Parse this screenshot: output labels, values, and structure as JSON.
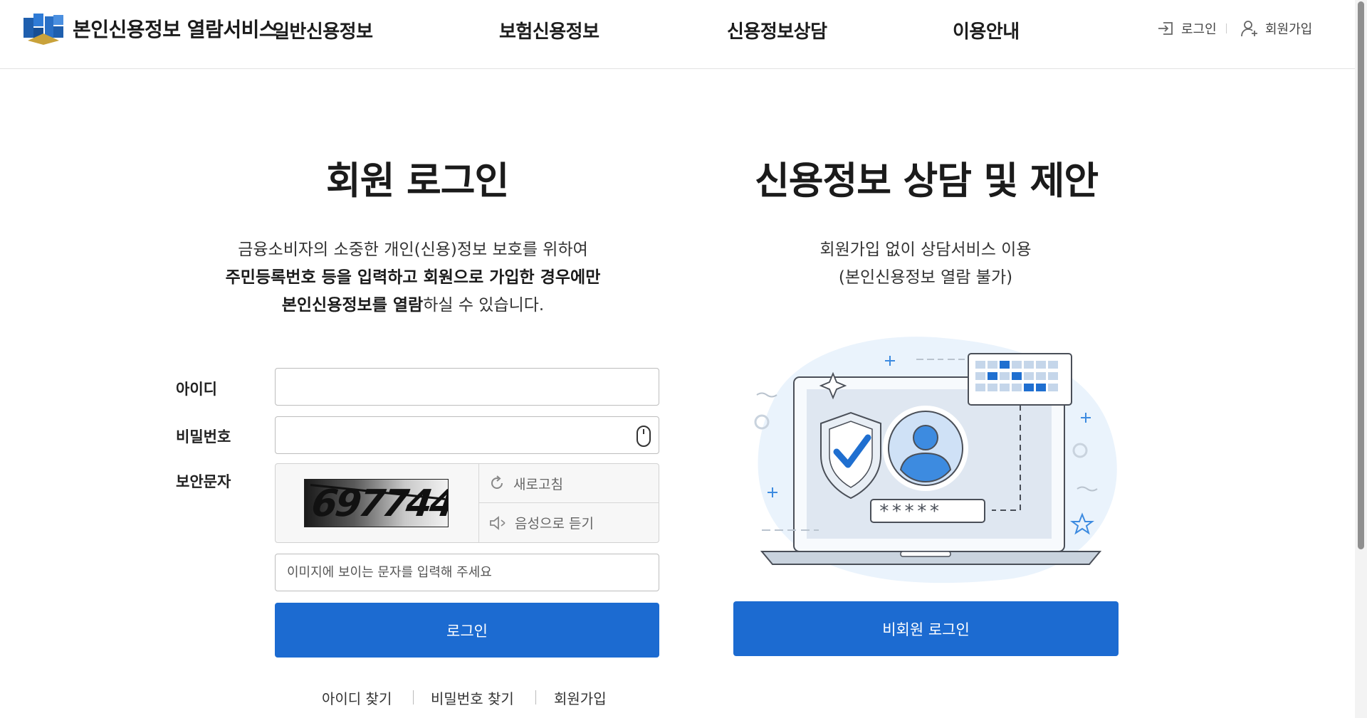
{
  "header": {
    "site_title": "본인신용정보 열람서비스",
    "nav": [
      "일반신용정보",
      "보험신용정보",
      "신용정보상담",
      "이용안내"
    ],
    "util": {
      "login_label": "로그인",
      "join_label": "회원가입"
    }
  },
  "member_login": {
    "title": "회원 로그인",
    "desc_line1": "금융소비자의 소중한 개인(신용)정보 보호를 위하여",
    "desc_line2_bold": "주민등록번호 등을 입력하고 회원으로 가입한 경우에만",
    "desc_line3_bold": "본인신용정보를 열람",
    "desc_line3_rest": "하실 수 있습니다.",
    "id_label": "아이디",
    "id_value": "",
    "password_label": "비밀번호",
    "password_value": "",
    "captcha_label": "보안문자",
    "captcha_image_text": "697744",
    "refresh_label": "새로고침",
    "audio_label": "음성으로 듣기",
    "captcha_placeholder": "이미지에 보이는 문자를 입력해 주세요",
    "login_button": "로그인",
    "links": {
      "find_id": "아이디 찾기",
      "find_password": "비밀번호 찾기",
      "join": "회원가입"
    }
  },
  "consult": {
    "title": "신용정보 상담 및 제안",
    "desc_line1": "회원가입 없이 상담서비스 이용",
    "desc_line2": "(본인신용정보 열람 불가)",
    "illustration_mask": "*****",
    "guest_login_button": "비회원 로그인"
  },
  "colors": {
    "primary": "#1c6bd1",
    "logo_blue": "#1f5fae",
    "logo_gold": "#c9a23a"
  },
  "icons": [
    "logo-icon",
    "login-icon",
    "user-plus-icon",
    "mouse-icon",
    "refresh-icon",
    "speaker-icon",
    "shield-check-icon",
    "user-avatar-icon",
    "star-icon"
  ]
}
